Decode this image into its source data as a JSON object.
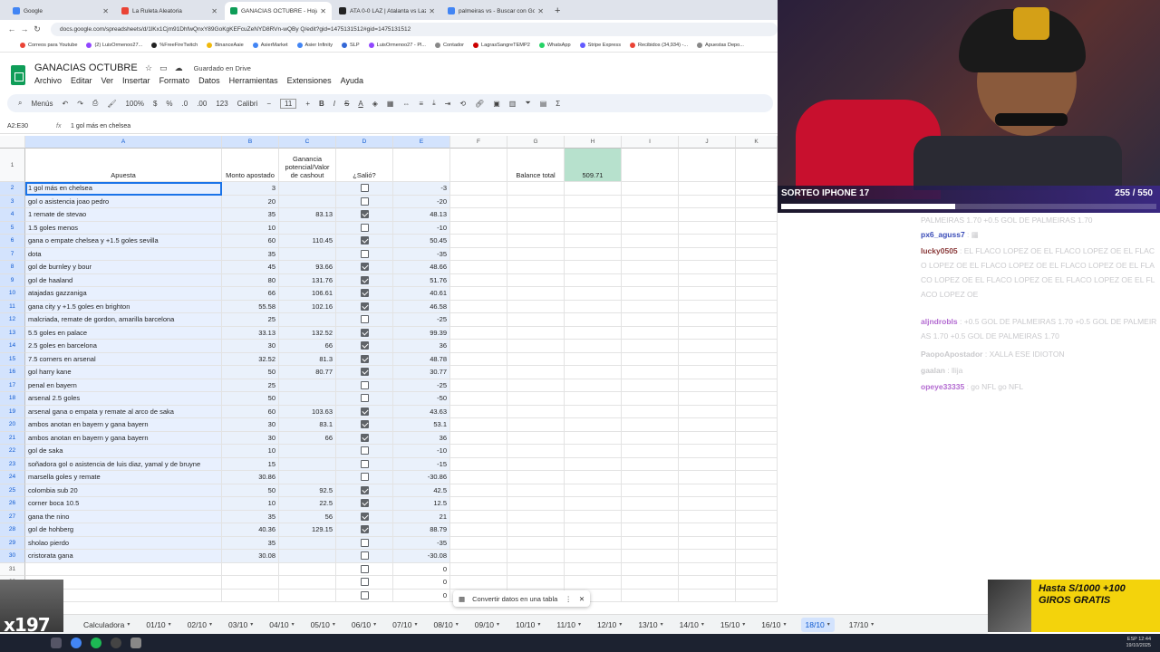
{
  "browser": {
    "tabs": [
      {
        "title": "Google",
        "color": "#4285f4",
        "active": false
      },
      {
        "title": "La Ruleta Aleatoria",
        "color": "#ea4335",
        "active": false
      },
      {
        "title": "GANACIAS OCTUBRE - Hojas de",
        "color": "#0f9d58",
        "active": true
      },
      {
        "title": "ATA 0-0 LAZ | Atalanta vs Lazio",
        "color": "#222222",
        "active": false
      },
      {
        "title": "palmeiras vs - Buscar con Goog",
        "color": "#4285f4",
        "active": false
      }
    ],
    "new_tab": "+",
    "url": "docs.google.com/spreadsheets/d/1lKx1Cjm91DhfwQnxY89GoKgKEFcuZeNYD8RVn-wQBy Q/edit?gid=1475131512#gid=1475131512",
    "bookmarks": [
      "Correos para Youtube",
      "(2) LuisOrmenoo27...",
      "%FreeFireTwitch",
      "BinanceAaie",
      "AsierMarket",
      "Asier Infinity",
      "SLP",
      "LuisOrmenoo27 - Pl...",
      "Contador",
      "LagrasSangreTEMP2",
      "WhatsApp",
      "Stripe Express",
      "Recibidos (34,934) -...",
      "Apuestas Depo..."
    ]
  },
  "sheet": {
    "title": "GANACIAS OCTUBRE",
    "saved_status": "Guardado en Drive",
    "menu": [
      "Archivo",
      "Editar",
      "Ver",
      "Insertar",
      "Formato",
      "Datos",
      "Herramientas",
      "Extensiones",
      "Ayuda"
    ],
    "toolbar": {
      "search": "Menús",
      "zoom": "100%",
      "currency": "$",
      "percent": "%",
      "dec_less": ".0",
      "dec_more": ".00",
      "format": "123",
      "font": "Calibri",
      "font_size": "11"
    },
    "name_box": "A2:E30",
    "formula": "1 gol más en chelsea",
    "columns": [
      "A",
      "B",
      "C",
      "D",
      "E",
      "F",
      "G",
      "H",
      "I",
      "J",
      "K"
    ],
    "headers": {
      "a": "Apuesta",
      "b": "Monto apostado",
      "c": "Ganancia potencial/Valor de cashout",
      "d": "¿Salió?",
      "g": "Balance total",
      "h": "509.71"
    },
    "rows": [
      {
        "n": "2",
        "a": "1 gol más en chelsea",
        "b": "3",
        "c": "",
        "d": false,
        "e": "-3"
      },
      {
        "n": "3",
        "a": "gol o asistencia joao pedro",
        "b": "20",
        "c": "",
        "d": false,
        "e": "-20"
      },
      {
        "n": "4",
        "a": "1 remate de stevao",
        "b": "35",
        "c": "83.13",
        "d": true,
        "e": "48.13"
      },
      {
        "n": "5",
        "a": "1.5 goles menos",
        "b": "10",
        "c": "",
        "d": false,
        "e": "-10"
      },
      {
        "n": "6",
        "a": "gana o empate chelsea y +1.5 goles sevilla",
        "b": "60",
        "c": "110.45",
        "d": true,
        "e": "50.45"
      },
      {
        "n": "7",
        "a": "dota",
        "b": "35",
        "c": "",
        "d": false,
        "e": "-35"
      },
      {
        "n": "8",
        "a": "gol de burnley y bour",
        "b": "45",
        "c": "93.66",
        "d": true,
        "e": "48.66"
      },
      {
        "n": "9",
        "a": "gol de haaland",
        "b": "80",
        "c": "131.76",
        "d": true,
        "e": "51.76"
      },
      {
        "n": "10",
        "a": "atajadas gazzaniga",
        "b": "66",
        "c": "106.61",
        "d": true,
        "e": "40.61"
      },
      {
        "n": "11",
        "a": "gana city y +1.5 goles en brighton",
        "b": "55.58",
        "c": "102.16",
        "d": true,
        "e": "46.58"
      },
      {
        "n": "12",
        "a": "malcriada, remate de gordon, amarilla barcelona",
        "b": "25",
        "c": "",
        "d": false,
        "e": "-25"
      },
      {
        "n": "13",
        "a": "5.5 goles en palace",
        "b": "33.13",
        "c": "132.52",
        "d": true,
        "e": "99.39"
      },
      {
        "n": "14",
        "a": "2.5 goles en barcelona",
        "b": "30",
        "c": "66",
        "d": true,
        "e": "36"
      },
      {
        "n": "15",
        "a": "7.5 corners en arsenal",
        "b": "32.52",
        "c": "81.3",
        "d": true,
        "e": "48.78"
      },
      {
        "n": "16",
        "a": "gol harry kane",
        "b": "50",
        "c": "80.77",
        "d": true,
        "e": "30.77"
      },
      {
        "n": "17",
        "a": "penal en bayern",
        "b": "25",
        "c": "",
        "d": false,
        "e": "-25"
      },
      {
        "n": "18",
        "a": "arsenal 2.5 goles",
        "b": "50",
        "c": "",
        "d": false,
        "e": "-50"
      },
      {
        "n": "19",
        "a": "arsenal gana o empata y remate al arco de saka",
        "b": "60",
        "c": "103.63",
        "d": true,
        "e": "43.63"
      },
      {
        "n": "20",
        "a": "ambos anotan en bayern y gana bayern",
        "b": "30",
        "c": "83.1",
        "d": true,
        "e": "53.1"
      },
      {
        "n": "21",
        "a": "ambos anotan en bayern y gana bayern",
        "b": "30",
        "c": "66",
        "d": true,
        "e": "36"
      },
      {
        "n": "22",
        "a": "gol de saka",
        "b": "10",
        "c": "",
        "d": false,
        "e": "-10"
      },
      {
        "n": "23",
        "a": "soñadora gol o asistencia de luis diaz, yamal y de bruyne",
        "b": "15",
        "c": "",
        "d": false,
        "e": "-15"
      },
      {
        "n": "24",
        "a": "marsella goles y remate",
        "b": "30.86",
        "c": "",
        "d": false,
        "e": "-30.86"
      },
      {
        "n": "25",
        "a": "colombia sub 20",
        "b": "50",
        "c": "92.5",
        "d": true,
        "e": "42.5"
      },
      {
        "n": "26",
        "a": "corner boca 10.5",
        "b": "10",
        "c": "22.5",
        "d": true,
        "e": "12.5"
      },
      {
        "n": "27",
        "a": "gana the nino",
        "b": "35",
        "c": "56",
        "d": true,
        "e": "21"
      },
      {
        "n": "28",
        "a": "gol de hohberg",
        "b": "40.36",
        "c": "129.15",
        "d": true,
        "e": "88.79"
      },
      {
        "n": "29",
        "a": "sholao pierdo",
        "b": "35",
        "c": "",
        "d": false,
        "e": "-35"
      },
      {
        "n": "30",
        "a": "cristorata gana",
        "b": "30.08",
        "c": "",
        "d": false,
        "e": "-30.08"
      },
      {
        "n": "31",
        "a": "",
        "b": "",
        "c": "",
        "d": false,
        "e": "0"
      },
      {
        "n": "32",
        "a": "",
        "b": "",
        "c": "",
        "d": false,
        "e": "0"
      },
      {
        "n": "33",
        "a": "",
        "b": "",
        "c": "",
        "d": false,
        "e": "0"
      }
    ],
    "toast": "Convertir datos en una tabla",
    "sheet_tabs": [
      "Calculadora",
      "01/10",
      "02/10",
      "03/10",
      "04/10",
      "05/10",
      "06/10",
      "07/10",
      "08/10",
      "09/10",
      "10/10",
      "11/10",
      "12/10",
      "13/10",
      "14/10",
      "15/10",
      "16/10",
      "18/10",
      "17/10"
    ],
    "active_sheet_tab": "18/10"
  },
  "stream": {
    "giveaway_title": "SORTEO IPHONE 17",
    "giveaway_count": "255 / 550",
    "giveaway_progress": 0.4636,
    "chat": [
      {
        "user": "",
        "text": "PALMEIRAS 1.70 +0.5 GOL DE PALMEIRAS 1.70",
        "color": "#c9c9cc"
      },
      {
        "user": "px6_aguss7",
        "text": ": ▦",
        "color": "#3b4db8"
      },
      {
        "user": "lucky0505",
        "text": ": EL FLACO LOPEZ OE EL FLACO LOPEZ OE EL FLACO LOPEZ OE EL FLACO LOPEZ OE EL FLACO LOPEZ OE EL FLACO LOPEZ OE EL FLACO LOPEZ OE EL FLACO LOPEZ OE EL FLACO LOPEZ OE",
        "color": "#8a3a3a"
      },
      {
        "user": "aljndrobls",
        "text": ": +0.5 GOL DE PALMEIRAS 1.70 +0.5 GOL DE PALMEIRAS 1.70 +0.5 GOL DE PALMEIRAS 1.70",
        "color": "#b36bd1"
      },
      {
        "user": "PaopoApostador",
        "text": ": XALLA ESE IDIOTON",
        "color": "#c9c9cc"
      },
      {
        "user": "gaalan",
        "text": ": llija",
        "color": "#c9c9cc"
      },
      {
        "user": "opeye33335",
        "text": ": go NFL go NFL",
        "color": "#b36bd1"
      }
    ],
    "promo": "Hasta S/1000 +100 GIROS GRATIS",
    "sticker": "x197"
  },
  "taskbar": {
    "time": "12:44",
    "date": "19/10/2025",
    "lang": "ESP"
  }
}
